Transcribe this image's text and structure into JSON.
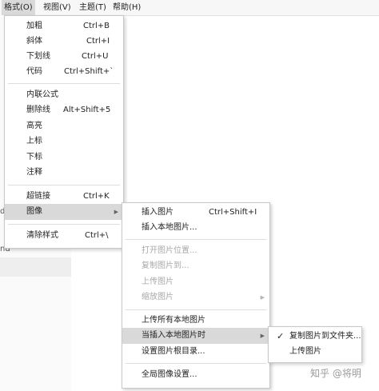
{
  "menubar": {
    "items": [
      "格式(O)",
      "视图(V)",
      "主题(T)",
      "帮助(H)"
    ]
  },
  "background": {
    "frag1": "d",
    "frag2": "nd"
  },
  "format_menu": {
    "items": [
      {
        "label": "加粗",
        "shortcut": "Ctrl+B"
      },
      {
        "label": "斜体",
        "shortcut": "Ctrl+I"
      },
      {
        "label": "下划线",
        "shortcut": "Ctrl+U"
      },
      {
        "label": "代码",
        "shortcut": "Ctrl+Shift+`"
      },
      {
        "label": "内联公式",
        "shortcut": ""
      },
      {
        "label": "删除线",
        "shortcut": "Alt+Shift+5"
      },
      {
        "label": "高亮",
        "shortcut": ""
      },
      {
        "label": "上标",
        "shortcut": ""
      },
      {
        "label": "下标",
        "shortcut": ""
      },
      {
        "label": "注释",
        "shortcut": ""
      },
      {
        "label": "超链接",
        "shortcut": "Ctrl+K"
      },
      {
        "label": "图像",
        "shortcut": ""
      },
      {
        "label": "清除样式",
        "shortcut": "Ctrl+\\"
      }
    ]
  },
  "image_menu": {
    "items": [
      {
        "label": "插入图片",
        "shortcut": "Ctrl+Shift+I"
      },
      {
        "label": "插入本地图片...",
        "shortcut": ""
      },
      {
        "label": "打开图片位置...",
        "shortcut": ""
      },
      {
        "label": "复制图片到...",
        "shortcut": ""
      },
      {
        "label": "上传图片",
        "shortcut": ""
      },
      {
        "label": "缩放图片",
        "shortcut": ""
      },
      {
        "label": "上传所有本地图片",
        "shortcut": ""
      },
      {
        "label": "当插入本地图片时",
        "shortcut": ""
      },
      {
        "label": "设置图片根目录...",
        "shortcut": ""
      },
      {
        "label": "全局图像设置...",
        "shortcut": ""
      }
    ]
  },
  "insert_menu": {
    "items": [
      {
        "label": "复制图片到文件夹...",
        "check": "✓"
      },
      {
        "label": "上传图片",
        "check": ""
      }
    ]
  },
  "watermark": "知乎 @将明"
}
